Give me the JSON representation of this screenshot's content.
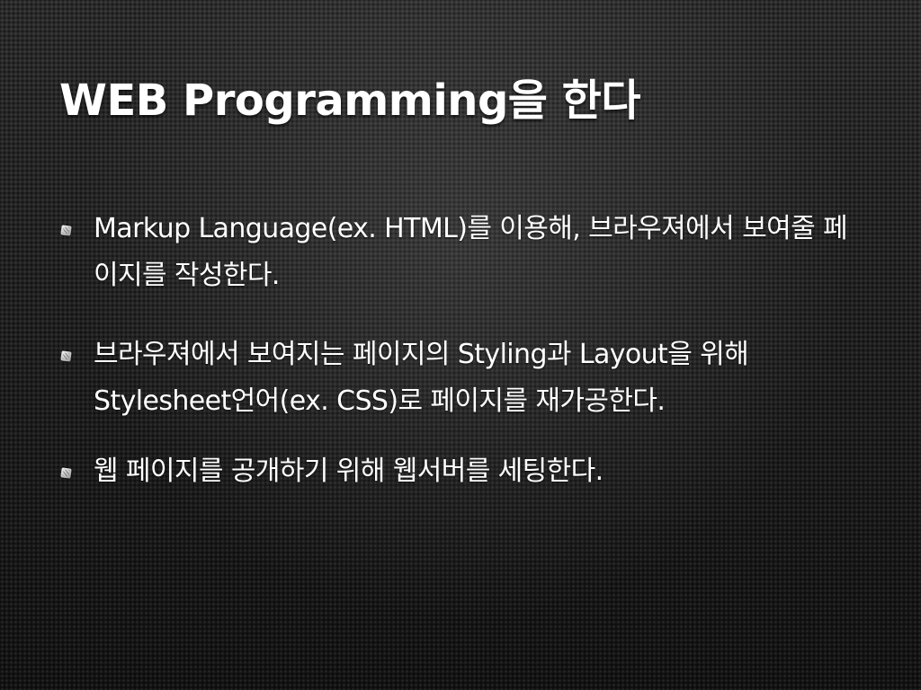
{
  "slide": {
    "title": "WEB Programming을 한다",
    "bullets": [
      {
        "text": "Markup Language(ex. HTML)를 이용해, 브라우져에서 보여줄 페이지를 작성한다."
      },
      {
        "text": "브라우져에서 보여지는 페이지의 Styling과 Layout을 위해 Stylesheet언어(ex. CSS)로 페이지를 재가공한다."
      },
      {
        "text": "웹 페이지를 공개하기 위해 웹서버를 세팅한다."
      }
    ]
  }
}
